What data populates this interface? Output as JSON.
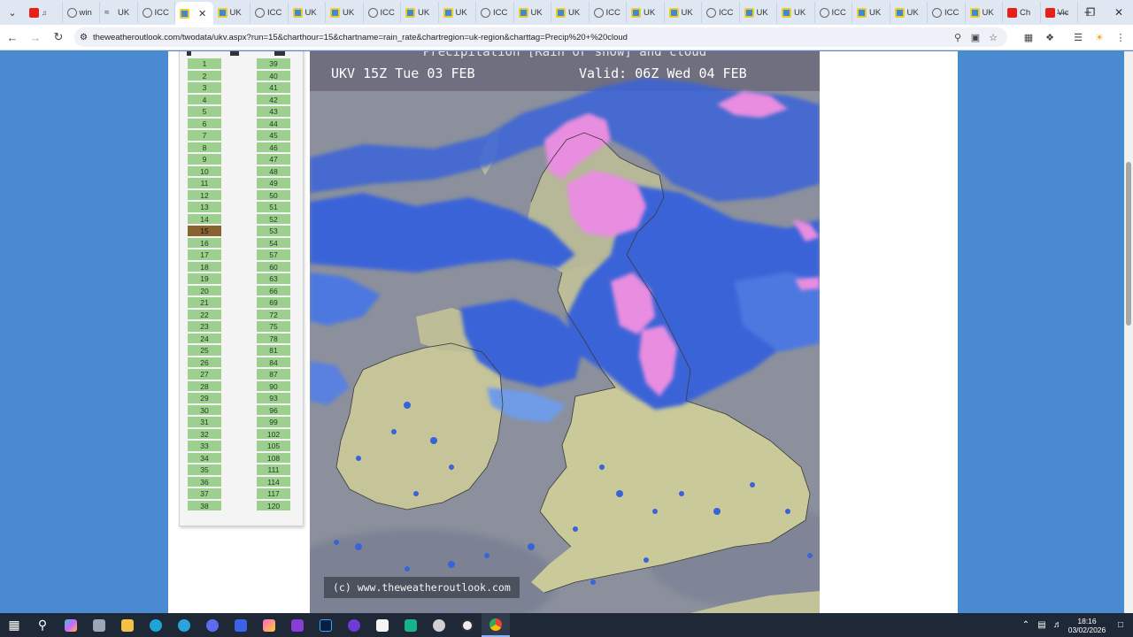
{
  "tabs": [
    {
      "label": "",
      "favicon": "youtube-icon",
      "extra": "speaker-icon"
    },
    {
      "label": "win",
      "favicon": "globe-icon"
    },
    {
      "label": "UK",
      "favicon": "wave-icon"
    },
    {
      "label": "ICC",
      "favicon": "globe-icon"
    },
    {
      "label": "",
      "favicon": "weatheroutlook-icon",
      "active": true
    },
    {
      "label": "UK",
      "favicon": "weatheroutlook-icon"
    },
    {
      "label": "ICC",
      "favicon": "globe-icon"
    },
    {
      "label": "UK",
      "favicon": "weatheroutlook-icon"
    },
    {
      "label": "UK",
      "favicon": "weatheroutlook-icon"
    },
    {
      "label": "ICC",
      "favicon": "globe-icon"
    },
    {
      "label": "UK",
      "favicon": "weatheroutlook-icon"
    },
    {
      "label": "UK",
      "favicon": "weatheroutlook-icon"
    },
    {
      "label": "ICC",
      "favicon": "globe-icon"
    },
    {
      "label": "UK",
      "favicon": "weatheroutlook-icon"
    },
    {
      "label": "UK",
      "favicon": "weatheroutlook-icon"
    },
    {
      "label": "ICC",
      "favicon": "globe-icon"
    },
    {
      "label": "UK",
      "favicon": "weatheroutlook-icon"
    },
    {
      "label": "UK",
      "favicon": "weatheroutlook-icon"
    },
    {
      "label": "ICC",
      "favicon": "globe-icon"
    },
    {
      "label": "UK",
      "favicon": "weatheroutlook-icon"
    },
    {
      "label": "UK",
      "favicon": "weatheroutlook-icon"
    },
    {
      "label": "ICC",
      "favicon": "globe-icon"
    },
    {
      "label": "UK",
      "favicon": "weatheroutlook-icon"
    },
    {
      "label": "UK",
      "favicon": "weatheroutlook-icon"
    },
    {
      "label": "ICC",
      "favicon": "globe-icon"
    },
    {
      "label": "UK",
      "favicon": "weatheroutlook-icon"
    },
    {
      "label": "Ch",
      "favicon": "youtube-icon"
    },
    {
      "label": "Vic",
      "favicon": "youtube-icon"
    }
  ],
  "address_bar": {
    "url": "theweatheroutlook.com/twodata/ukv.aspx?run=15&charthour=15&chartname=rain_rate&chartregion=uk-region&charttag=Precip%20+%20cloud"
  },
  "hour_panel": {
    "selected_hour": "15",
    "left_column": [
      "1",
      "2",
      "3",
      "4",
      "5",
      "6",
      "7",
      "8",
      "9",
      "10",
      "11",
      "12",
      "13",
      "14",
      "15",
      "16",
      "17",
      "18",
      "19",
      "20",
      "21",
      "22",
      "23",
      "24",
      "25",
      "26",
      "27",
      "28",
      "29",
      "30",
      "31",
      "32",
      "33",
      "34",
      "35",
      "36",
      "37",
      "38"
    ],
    "right_column": [
      "39",
      "40",
      "41",
      "42",
      "43",
      "44",
      "45",
      "46",
      "47",
      "48",
      "49",
      "50",
      "51",
      "52",
      "53",
      "54",
      "57",
      "60",
      "63",
      "66",
      "69",
      "72",
      "75",
      "78",
      "81",
      "84",
      "87",
      "90",
      "93",
      "96",
      "99",
      "102",
      "105",
      "108",
      "111",
      "114",
      "117",
      "120"
    ]
  },
  "chart": {
    "title": "Precipitation [Rain or snow] and cloud",
    "run_label": "UKV 15Z Tue 03 FEB",
    "valid_label": "Valid: 06Z Wed 04 FEB",
    "credit": "(c) www.theweatheroutlook.com",
    "colors": {
      "cloud": "#8a8f9b",
      "land": "#c9c99a",
      "rain": "#3a63d8",
      "rain_light": "#6f9be6",
      "snow": "#e88de0"
    }
  },
  "taskbar": {
    "time": "18:16",
    "date": "03/02/2026"
  },
  "colors": {
    "page_background": "#4a8ad0",
    "hour_cell": "#9dcf8e",
    "hour_selected": "#8a6230"
  }
}
